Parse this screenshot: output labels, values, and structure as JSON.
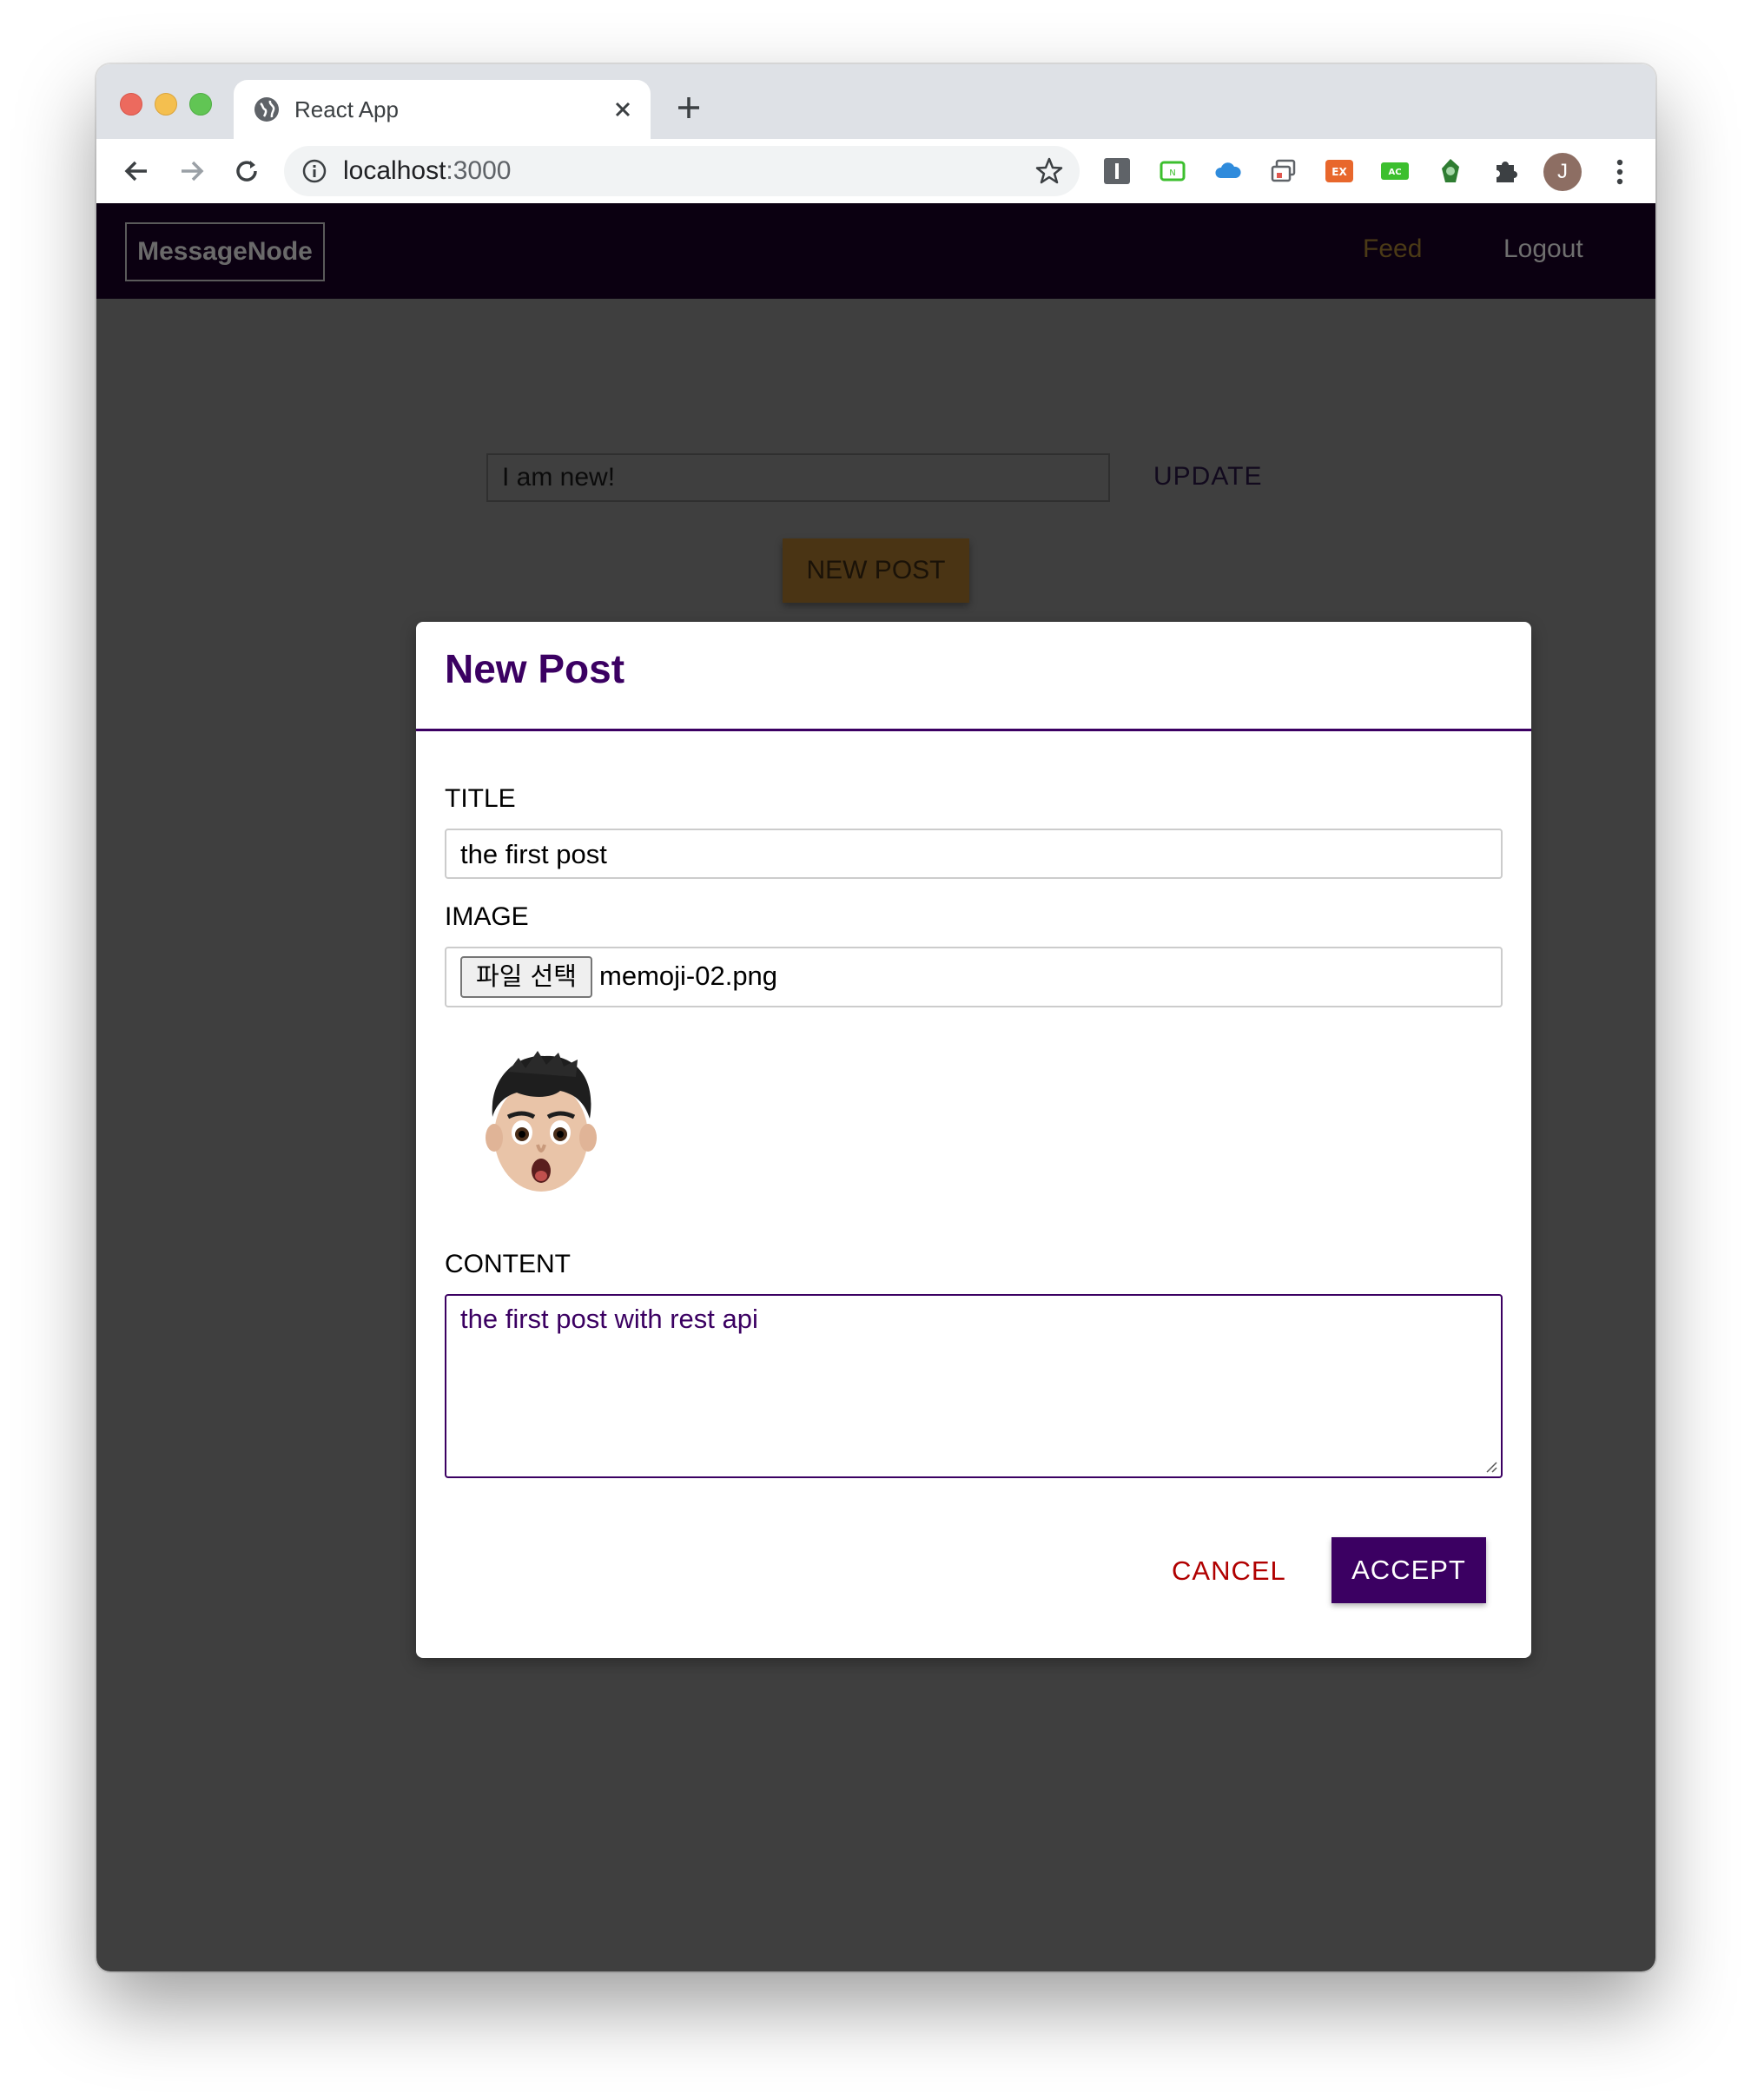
{
  "browser": {
    "tab_title": "React App",
    "url_host": "localhost",
    "url_port": ":3000",
    "profile_initial": "J"
  },
  "app": {
    "logo": "MessageNode",
    "nav": {
      "feed": "Feed",
      "logout": "Logout"
    },
    "status": {
      "value": "I am new!",
      "update_label": "UPDATE"
    },
    "new_post_label": "NEW POST"
  },
  "modal": {
    "title": "New Post",
    "title_label": "TITLE",
    "title_value": "the first post",
    "image_label": "IMAGE",
    "file_button_label": "파일 선택",
    "file_name": "memoji-02.png",
    "content_label": "CONTENT",
    "content_value": "the first post with rest api",
    "cancel_label": "CANCEL",
    "accept_label": "ACCEPT"
  },
  "colors": {
    "accent": "#3b0062",
    "cancel": "#b00000",
    "overlay": "#3f3f3f",
    "nav_bg": "#0b0011"
  }
}
